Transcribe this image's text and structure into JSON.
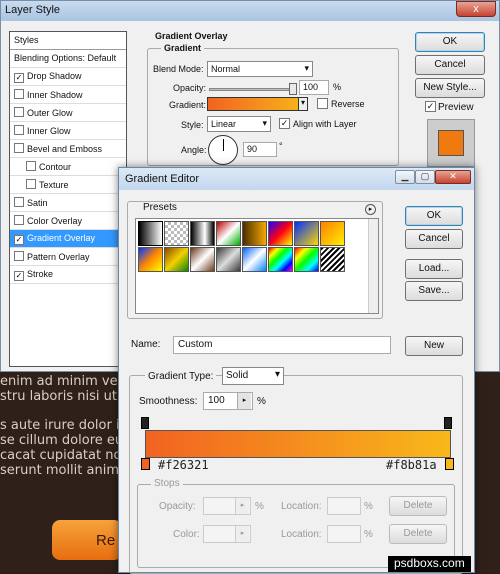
{
  "background_page": {
    "lines": [
      "enim ad minim venia",
      "stru laboris nisi ut e",
      "s aute irure dolor in",
      "se cillum dolore eu fu",
      "cacat cupidatat no",
      "serunt mollit anim id"
    ],
    "button_label": "Re",
    "brand": "psdboxs.com"
  },
  "layer_style": {
    "title": "Layer Style",
    "close": "x",
    "styles_header": "Styles",
    "list": [
      {
        "label": "Blending Options: Default",
        "check": false,
        "box": false
      },
      {
        "label": "Drop Shadow",
        "check": true,
        "box": true
      },
      {
        "label": "Inner Shadow",
        "check": false,
        "box": true
      },
      {
        "label": "Outer Glow",
        "check": false,
        "box": true
      },
      {
        "label": "Inner Glow",
        "check": false,
        "box": true
      },
      {
        "label": "Bevel and Emboss",
        "check": false,
        "box": true
      },
      {
        "label": "Contour",
        "check": false,
        "box": true
      },
      {
        "label": "Texture",
        "check": false,
        "box": true
      },
      {
        "label": "Satin",
        "check": false,
        "box": true
      },
      {
        "label": "Color Overlay",
        "check": false,
        "box": true
      },
      {
        "label": "Gradient Overlay",
        "check": true,
        "box": true,
        "selected": true
      },
      {
        "label": "Pattern Overlay",
        "check": false,
        "box": true
      },
      {
        "label": "Stroke",
        "check": true,
        "box": true
      }
    ],
    "section_title": "Gradient Overlay",
    "group_title": "Gradient",
    "blend_mode_label": "Blend Mode:",
    "blend_mode_value": "Normal",
    "opacity_label": "Opacity:",
    "opacity_value": "100",
    "opacity_unit": "%",
    "gradient_label": "Gradient:",
    "reverse_label": "Reverse",
    "style_label": "Style:",
    "style_value": "Linear",
    "align_label": "Align with Layer",
    "angle_label": "Angle:",
    "angle_value": "90",
    "angle_unit": "°",
    "ok": "OK",
    "cancel": "Cancel",
    "new_style": "New Style...",
    "preview_label": "Preview",
    "preview_color": "#f07a10"
  },
  "gradient_editor": {
    "title": "Gradient Editor",
    "presets_label": "Presets",
    "ok": "OK",
    "cancel": "Cancel",
    "load": "Load...",
    "save": "Save...",
    "name_label": "Name:",
    "name_value": "Custom",
    "new": "New",
    "type_label": "Gradient Type:",
    "type_value": "Solid",
    "smooth_label": "Smoothness:",
    "smooth_value": "100",
    "smooth_unit": "%",
    "color_start": "#f26321",
    "color_end": "#f8b81a",
    "color_start_label": "#f26321",
    "color_end_label": "#f8b81a",
    "stops_label": "Stops",
    "stop_opacity_label": "Opacity:",
    "stop_color_label": "Color:",
    "location_label": "Location:",
    "pct": "%",
    "delete": "Delete"
  }
}
